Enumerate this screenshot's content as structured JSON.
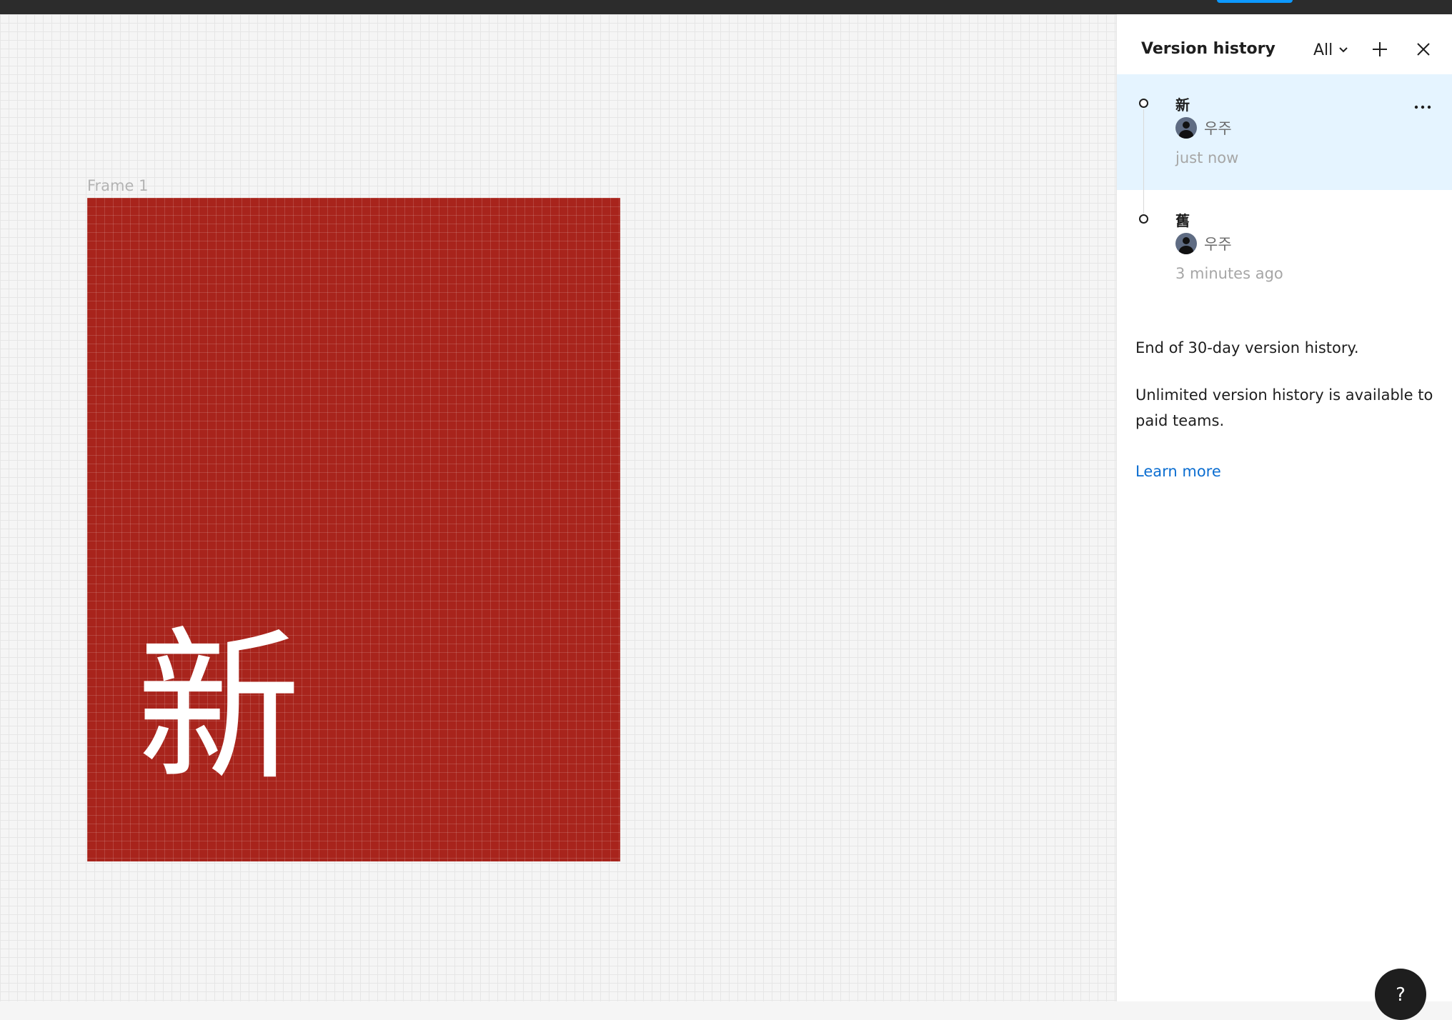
{
  "canvas": {
    "frame_label": "Frame 1",
    "frame_text": "新",
    "frame_color": "#a8241c"
  },
  "panel": {
    "title": "Version history",
    "filter_label": "All",
    "filter_icon": "chevron-down-icon",
    "add_icon": "plus-icon",
    "close_icon": "close-icon",
    "versions": [
      {
        "name": "新",
        "user": "우주",
        "time": "just now",
        "selected": true,
        "menu_icon": "more-icon"
      },
      {
        "name": "舊",
        "user": "우주",
        "time": "3 minutes ago",
        "selected": false
      }
    ],
    "end_text": "End of 30-day version history.",
    "unlimited_text": "Unlimited version history is available to paid teams.",
    "learn_more": "Learn more"
  },
  "help": {
    "label": "?"
  },
  "colors": {
    "accent": "#0d99ff",
    "link": "#0c6ed1",
    "selected_bg": "#e5f4ff"
  }
}
